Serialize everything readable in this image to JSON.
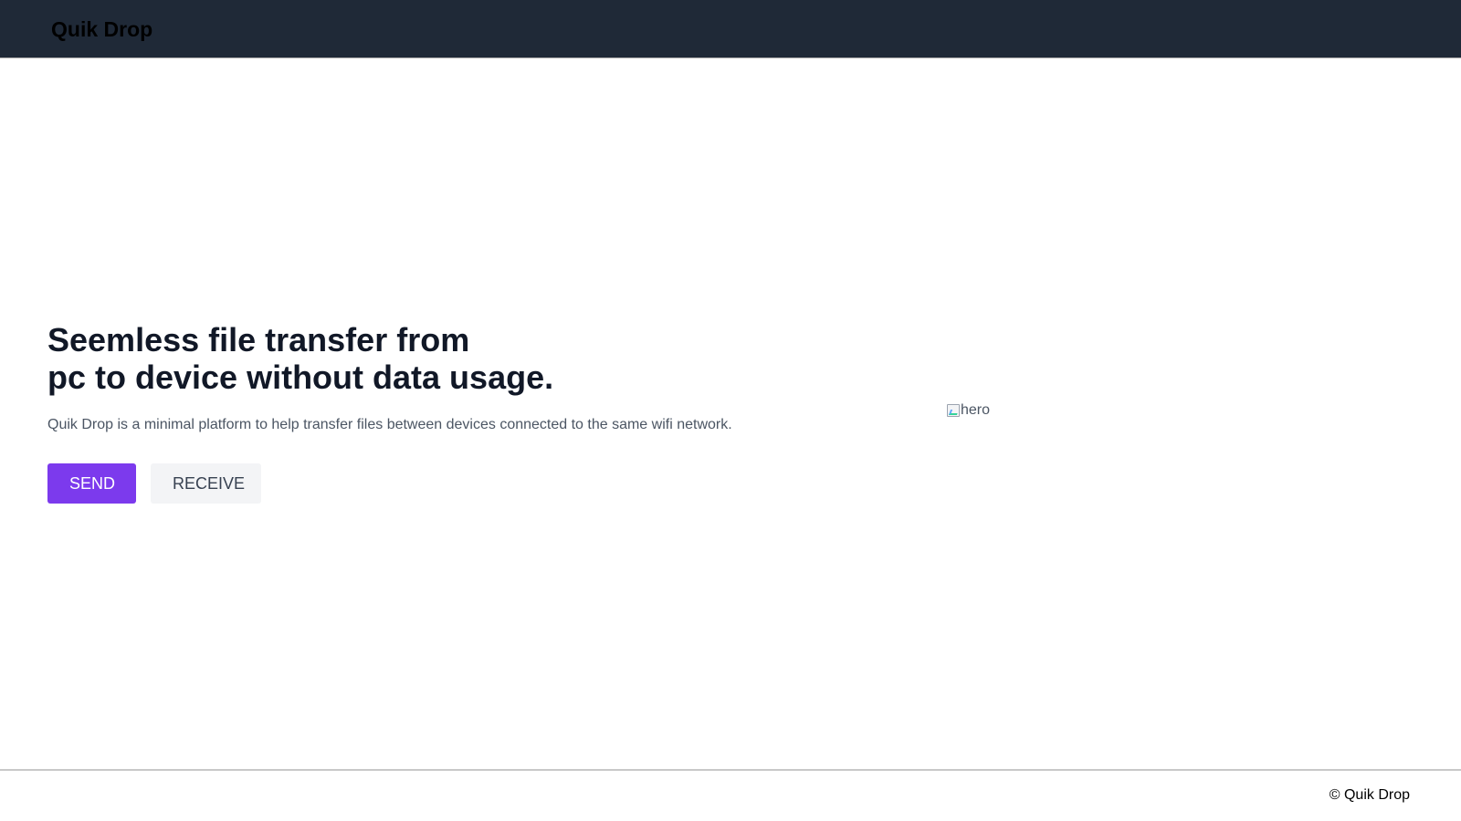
{
  "header": {
    "brand": "Quik Drop"
  },
  "hero": {
    "headline_line1": "Seemless file transfer from",
    "headline_line2": "pc to device without data usage.",
    "description": "Quik Drop is a minimal platform to help transfer files between devices connected to the same wifi network.",
    "send_label": "SEND",
    "receive_label": "RECEIVE",
    "image_alt": "hero"
  },
  "footer": {
    "copyright": "© Quik Drop"
  },
  "colors": {
    "navbar": "#1f2937",
    "primary": "#7c3aed",
    "secondary_button": "#f3f4f6",
    "text_dark": "#111827",
    "text_muted": "#4b5563"
  },
  "icons": {
    "hero_image": "broken-image-icon"
  }
}
